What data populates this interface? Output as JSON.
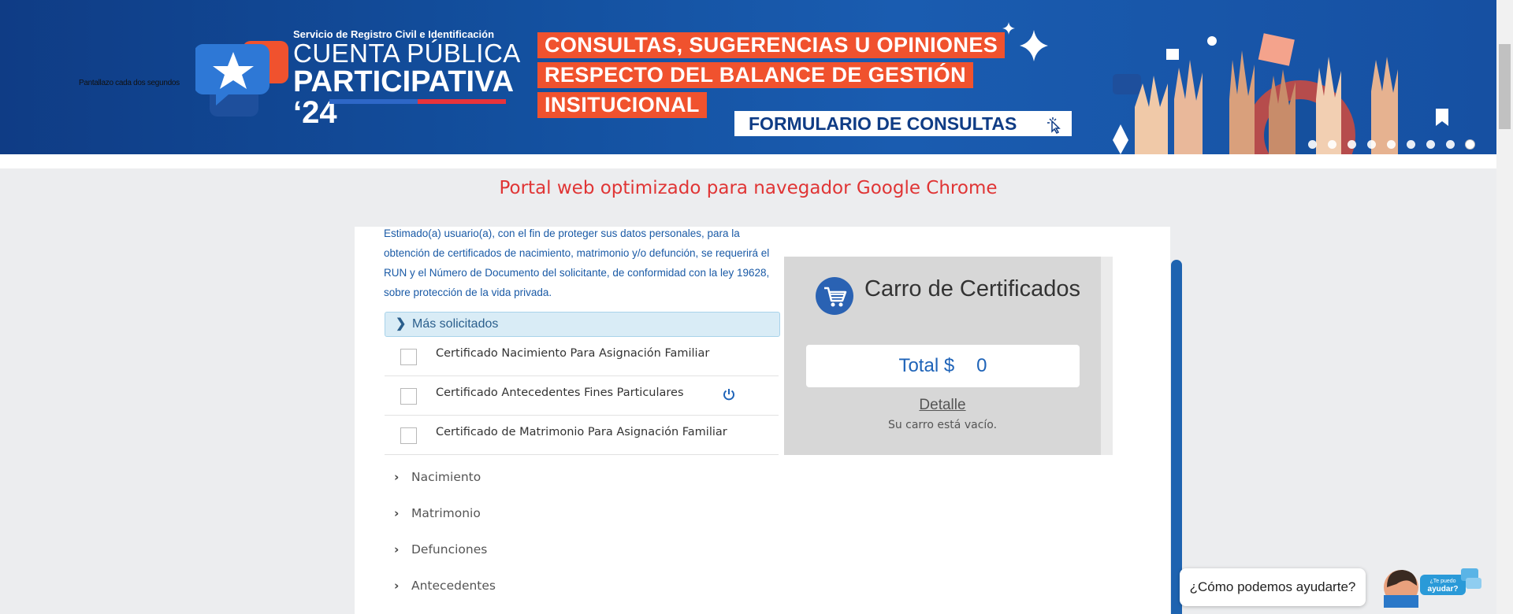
{
  "banner": {
    "rotator_caption": "Pantallazo cada dos segundos",
    "logo": {
      "agency": "Servicio de Registro Civil e Identificación",
      "line1": "CUENTA PÚBLICA",
      "line2": "PARTICIPATIVA",
      "line3": "‘24"
    },
    "headline": [
      "CONSULTAS, SUGERENCIAS U OPINIONES",
      "RESPECTO DEL BALANCE DE GESTIÓN",
      "INSITUCIONAL"
    ],
    "cta_label": "FORMULARIO DE CONSULTAS",
    "slide_count": 9,
    "active_slide": 9
  },
  "browser_note": "Portal web optimizado para navegador Google Chrome",
  "notice": "Estimado(a) usuario(a), con el fin de proteger sus datos personales, para la obtención de certificados de nacimiento, matrimonio y/o defunción, se requerirá el RUN y el Número de Documento del solicitante, de conformidad con la ley 19628, sobre protección de la vida privada.",
  "most_requested": {
    "heading": "Más solicitados",
    "items": [
      {
        "label": "Certificado Nacimiento Para Asignación Familiar"
      },
      {
        "label": "Certificado Antecedentes Fines Particulares"
      },
      {
        "label": "Certificado de Matrimonio Para Asignación Familiar"
      }
    ]
  },
  "categories": [
    "Nacimiento",
    "Matrimonio",
    "Defunciones",
    "Antecedentes"
  ],
  "cart": {
    "title": "Carro de Certificados",
    "total_label": "Total $",
    "total_value": "0",
    "detail_link": "Detalle",
    "empty_message": "Su carro está vacío."
  },
  "chat": {
    "prompt": "¿Cómo podemos ayudarte?",
    "badge": "¿Te puedo ayudar?"
  },
  "colors": {
    "banner_blue": "#13509f",
    "headline_orange": "#f0522e",
    "notice_blue": "#1a5aa6",
    "browser_note_red": "#e03535",
    "accent_blue": "#1e63b8"
  }
}
